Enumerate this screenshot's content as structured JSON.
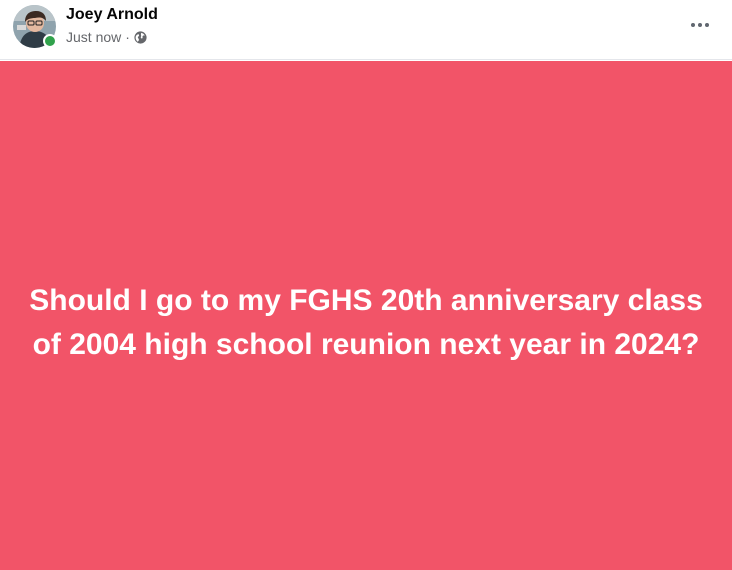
{
  "post": {
    "author": "Joey Arnold",
    "timestamp": "Just now",
    "separator": "·",
    "privacy_icon": "globe-icon",
    "more_icon": "more-options-icon",
    "online": true,
    "text": "Should I go to my FGHS 20th anniversary class of 2004 high school reunion next year in 2024?",
    "background_color": "#f25468",
    "online_color": "#31a24c"
  }
}
